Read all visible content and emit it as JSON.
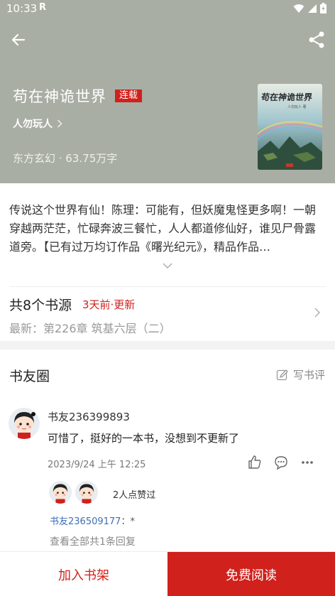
{
  "status_bar": {
    "time": "10:33",
    "notification_letter": "R"
  },
  "book": {
    "title": "苟在神诡世界",
    "status_badge": "连载",
    "author": "人勿玩人",
    "meta": "东方玄幻 · 63.75万字",
    "description": "传说这个世界有仙！陈理：可能有，但妖魔鬼怪更多啊！一朝穿越两茫茫，忙碌奔波三餐忙，人人都道修仙好，谁见尸骨露道旁。【已有过万均订作品《曙光纪元》，精品作品…",
    "cover_title": "苟在神诡世界",
    "cover_author": "人勿玩人 著"
  },
  "sources": {
    "title": "共8个书源",
    "update": "3天前·更新",
    "latest": "最新：第226章 筑基六层（二）"
  },
  "circle": {
    "title": "书友圈",
    "write_review": "写书评"
  },
  "review": {
    "user": "书友236399893",
    "text": "可惜了，挺好的一本书，没想到不更新了",
    "time": "2023/9/24 上午 12:25",
    "likes_text": "2人点赞过",
    "reply_user": "书友236509177",
    "reply_text": "：*",
    "view_all": "查看全部共1条回复"
  },
  "bottom": {
    "add_shelf": "加入书架",
    "free_read": "免费阅读"
  },
  "colors": {
    "header_bg": "#a9aea4",
    "accent": "#d0211c",
    "link": "#3b6fb6"
  },
  "icons": [
    "back-arrow-icon",
    "share-icon",
    "chevron-right-icon",
    "chevron-down-icon",
    "edit-icon",
    "thumbs-up-icon",
    "comment-icon",
    "more-icon",
    "wifi-icon",
    "signal-icon",
    "battery-icon"
  ]
}
